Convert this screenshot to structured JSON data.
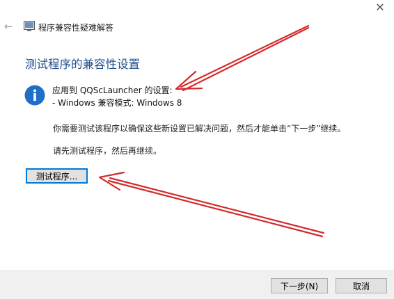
{
  "window": {
    "title": "程序兼容性疑难解答",
    "close_glyph": "✕",
    "back_glyph": "←"
  },
  "main": {
    "heading": "测试程序的兼容性设置",
    "apply_to": "应用到 QQScLauncher 的设置:",
    "compat_mode": "- Windows 兼容模式: Windows 8",
    "instruction": "你需要测试该程序以确保这些新设置已解决问题，然后才能单击“下一步”继续。",
    "instruction2": "请先测试程序，然后再继续。",
    "test_button": "测试程序..."
  },
  "footer": {
    "next_button": "下一步(N)",
    "cancel_button": "取消"
  },
  "colors": {
    "heading": "#1f4e8c",
    "info_icon": "#1f6fc9",
    "focus_border": "#0078d7",
    "annotation_arrow": "#d42a2a"
  }
}
